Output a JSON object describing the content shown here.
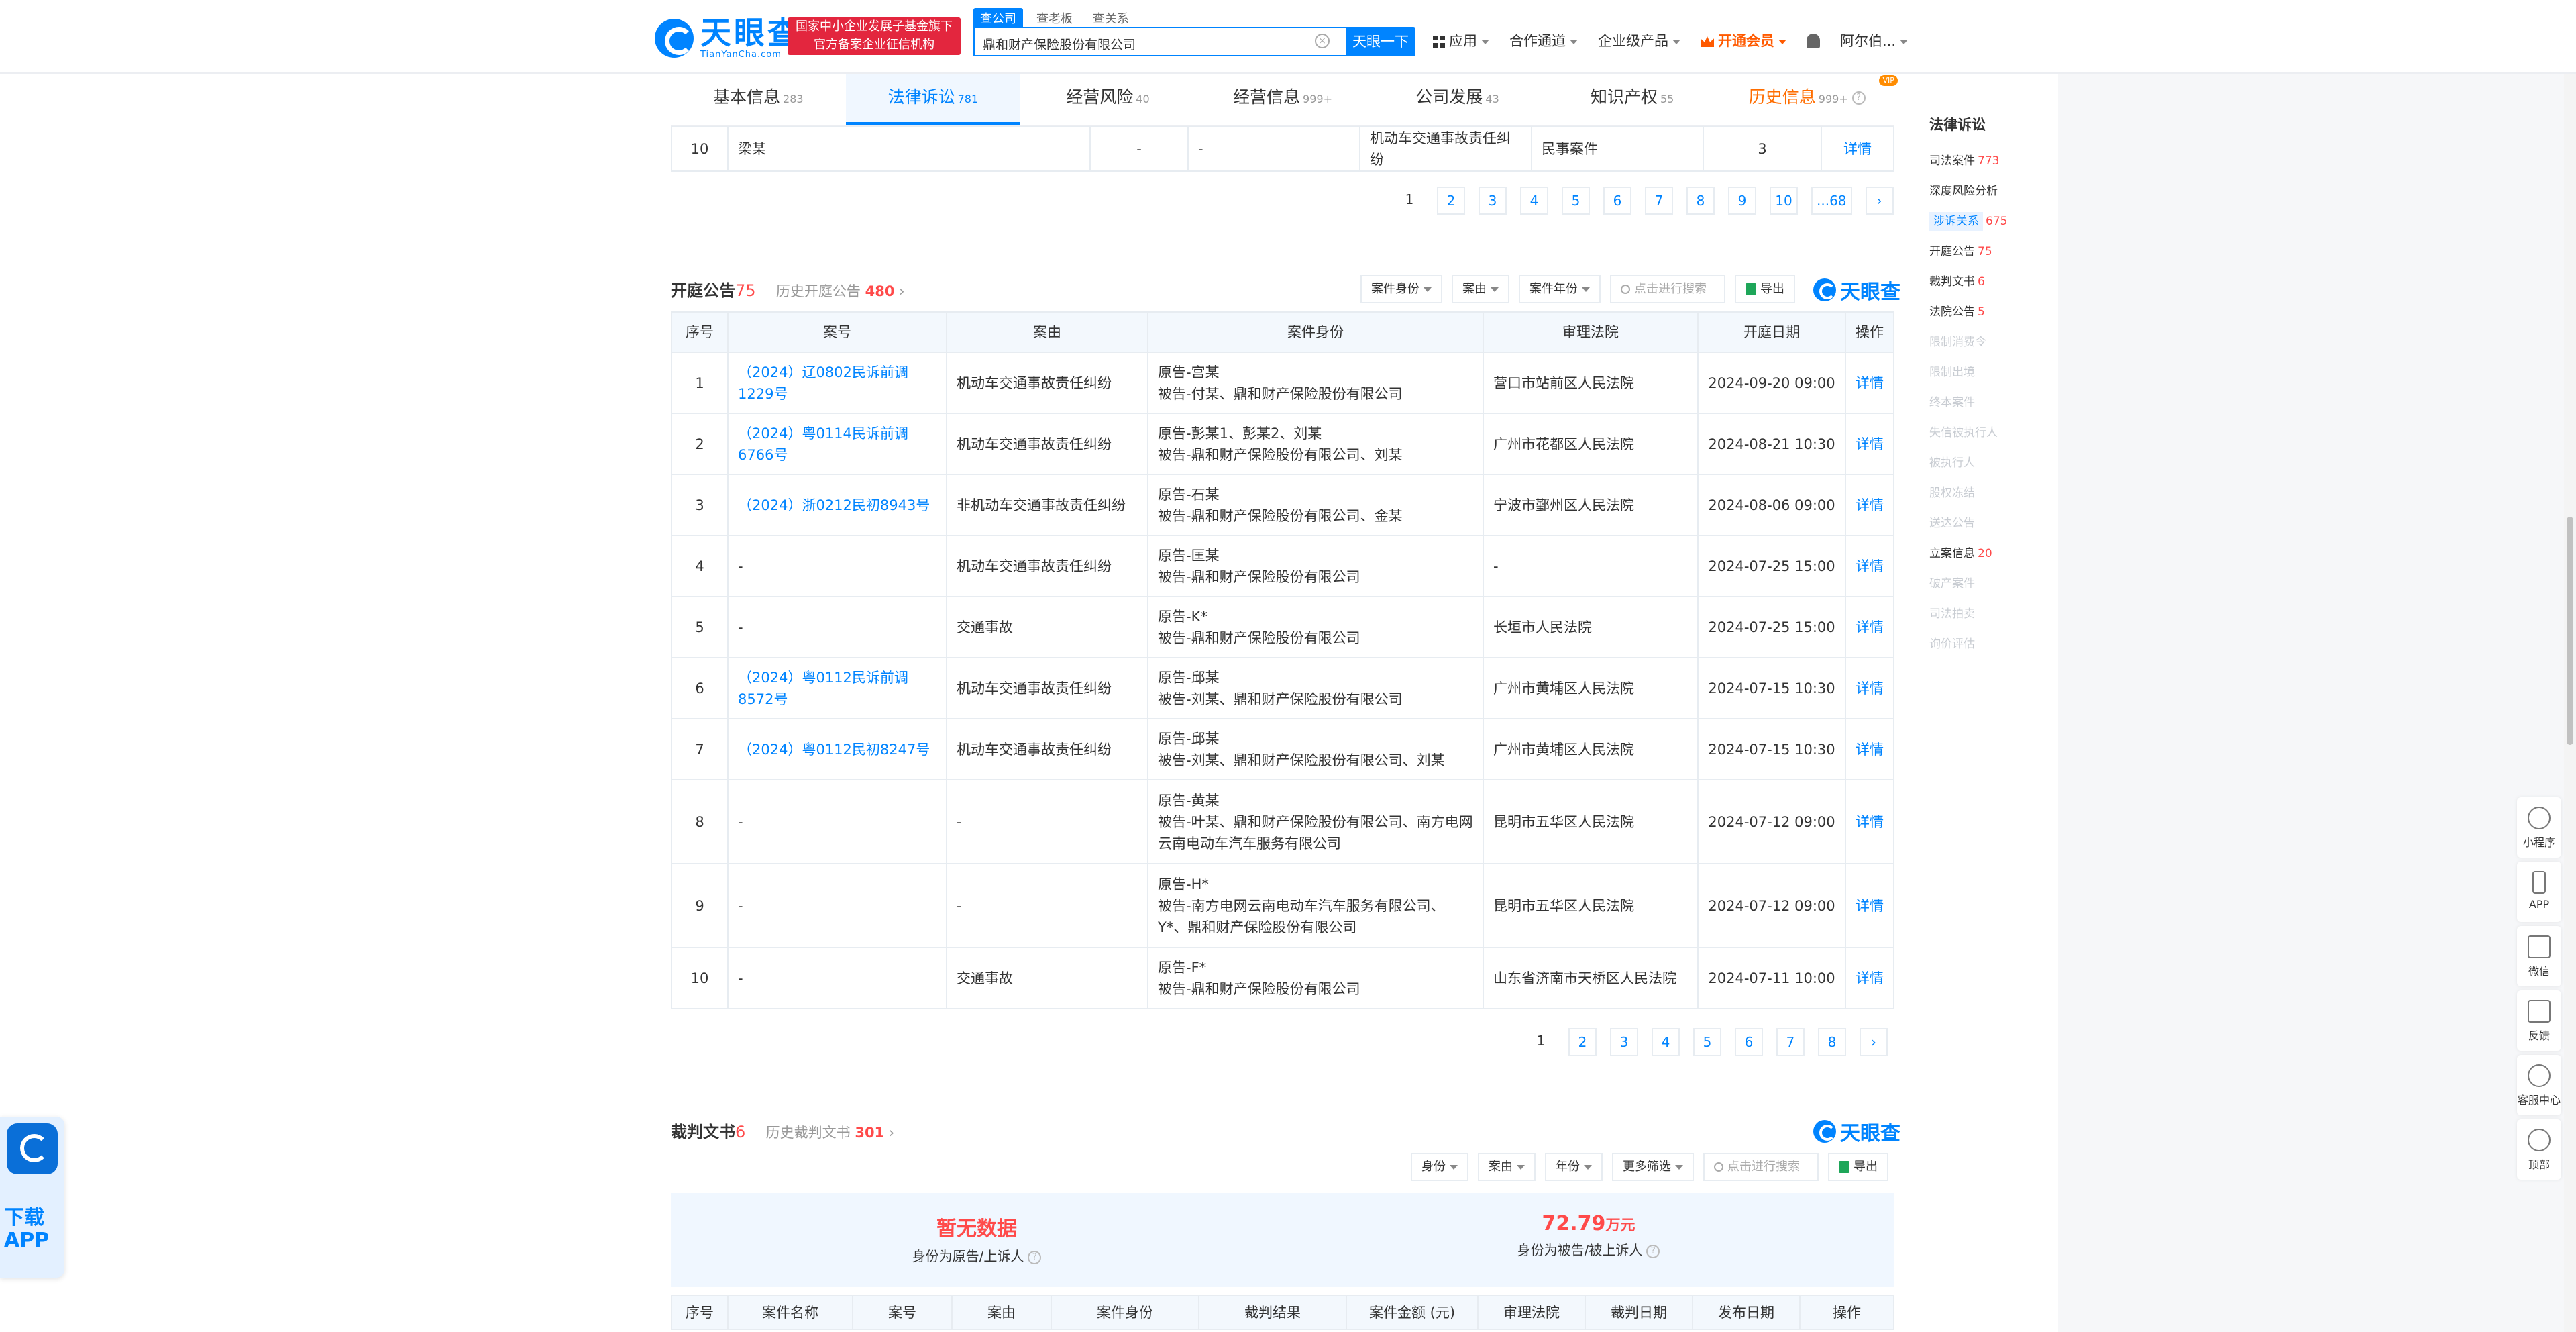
{
  "header": {
    "logo_cn": "天眼查",
    "logo_en": "TianYanCha.com",
    "badge_line1": "国家中小企业发展子基金旗下",
    "badge_line2": "官方备案企业征信机构",
    "search_tabs": [
      "查公司",
      "查老板",
      "查关系"
    ],
    "search_value": "鼎和财产保险股份有限公司",
    "search_button": "天眼一下",
    "nav": [
      "应用",
      "合作通道",
      "企业级产品",
      "开通会员",
      "阿尔伯..."
    ]
  },
  "tabs": [
    {
      "label": "基本信息",
      "count": "283"
    },
    {
      "label": "法律诉讼",
      "count": "781"
    },
    {
      "label": "经营风险",
      "count": "40"
    },
    {
      "label": "经营信息",
      "count": "999+"
    },
    {
      "label": "公司发展",
      "count": "43"
    },
    {
      "label": "知识产权",
      "count": "55"
    },
    {
      "label": "历史信息",
      "count": "999+"
    }
  ],
  "vip_tag": "VIP",
  "prev_table": {
    "row": {
      "no": "10",
      "party": "梁某",
      "c1": "-",
      "c2": "-",
      "reason": "机动车交通事故责任纠纷",
      "type": "民事案件",
      "count": "3",
      "action": "详情"
    }
  },
  "pager1": [
    "1",
    "2",
    "3",
    "4",
    "5",
    "6",
    "7",
    "8",
    "9",
    "10",
    "...68",
    "›"
  ],
  "court_notice": {
    "title": "开庭公告",
    "count": "75",
    "hist_label": "历史开庭公告",
    "hist_count": "480",
    "filters": [
      "案件身份",
      "案由",
      "案件年份"
    ],
    "search_placeholder": "点击进行搜索",
    "export": "导出",
    "brand": "天眼查",
    "headers": [
      "序号",
      "案号",
      "案由",
      "案件身份",
      "审理法院",
      "开庭日期",
      "操作"
    ],
    "rows": [
      {
        "no": "1",
        "case": "（2024）辽0802民诉前调1229号",
        "reason": "机动车交通事故责任纠纷",
        "plaintiff": "原告-宫某",
        "defendant": "被告-付某、鼎和财产保险股份有限公司",
        "court": "营口市站前区人民法院",
        "date": "2024-09-20 09:00",
        "action": "详情"
      },
      {
        "no": "2",
        "case": "（2024）粤0114民诉前调6766号",
        "reason": "机动车交通事故责任纠纷",
        "plaintiff": "原告-彭某1、彭某2、刘某",
        "defendant": "被告-鼎和财产保险股份有限公司、刘某",
        "court": "广州市花都区人民法院",
        "date": "2024-08-21 10:30",
        "action": "详情"
      },
      {
        "no": "3",
        "case": "（2024）浙0212民初8943号",
        "reason": "非机动车交通事故责任纠纷",
        "plaintiff": "原告-石某",
        "defendant": "被告-鼎和财产保险股份有限公司、金某",
        "court": "宁波市鄞州区人民法院",
        "date": "2024-08-06 09:00",
        "action": "详情"
      },
      {
        "no": "4",
        "case": "-",
        "reason": "机动车交通事故责任纠纷",
        "plaintiff": "原告-匡某",
        "defendant": "被告-鼎和财产保险股份有限公司",
        "court": "-",
        "date": "2024-07-25 15:00",
        "action": "详情"
      },
      {
        "no": "5",
        "case": "-",
        "reason": "交通事故",
        "plaintiff": "原告-K*",
        "defendant": "被告-鼎和财产保险股份有限公司",
        "court": "长垣市人民法院",
        "date": "2024-07-25 15:00",
        "action": "详情"
      },
      {
        "no": "6",
        "case": "（2024）粤0112民诉前调8572号",
        "reason": "机动车交通事故责任纠纷",
        "plaintiff": "原告-邱某",
        "defendant": "被告-刘某、鼎和财产保险股份有限公司",
        "court": "广州市黄埔区人民法院",
        "date": "2024-07-15 10:30",
        "action": "详情"
      },
      {
        "no": "7",
        "case": "（2024）粤0112民初8247号",
        "reason": "机动车交通事故责任纠纷",
        "plaintiff": "原告-邱某",
        "defendant": "被告-刘某、鼎和财产保险股份有限公司、刘某",
        "court": "广州市黄埔区人民法院",
        "date": "2024-07-15 10:30",
        "action": "详情"
      },
      {
        "no": "8",
        "case": "-",
        "reason": "-",
        "plaintiff": "原告-黄某",
        "defendant": "被告-叶某、鼎和财产保险股份有限公司、南方电网云南电动车汽车服务有限公司",
        "court": "昆明市五华区人民法院",
        "date": "2024-07-12 09:00",
        "action": "详情"
      },
      {
        "no": "9",
        "case": "-",
        "reason": "-",
        "plaintiff": "原告-H*",
        "defendant": "被告-南方电网云南电动车汽车服务有限公司、Y*、鼎和财产保险股份有限公司",
        "court": "昆明市五华区人民法院",
        "date": "2024-07-12 09:00",
        "action": "详情"
      },
      {
        "no": "10",
        "case": "-",
        "reason": "交通事故",
        "plaintiff": "原告-F*",
        "defendant": "被告-鼎和财产保险股份有限公司",
        "court": "山东省济南市天桥区人民法院",
        "date": "2024-07-11 10:00",
        "action": "详情"
      }
    ]
  },
  "pager2": [
    "1",
    "2",
    "3",
    "4",
    "5",
    "6",
    "7",
    "8",
    "›"
  ],
  "judgment": {
    "title": "裁判文书",
    "count": "6",
    "hist_label": "历史裁判文书",
    "hist_count": "301",
    "filters": [
      "身份",
      "案由",
      "年份",
      "更多筛选"
    ],
    "search_placeholder": "点击进行搜索",
    "export": "导出",
    "brand": "天眼查",
    "stat_left_value": "暂无数据",
    "stat_left_label": "身份为原告/上诉人",
    "stat_right_value": "72.79",
    "stat_right_unit": "万元",
    "stat_right_label": "身份为被告/被上诉人",
    "headers": [
      "序号",
      "案件名称",
      "案号",
      "案由",
      "案件身份",
      "裁判结果",
      "案件金额 (元)",
      "审理法院",
      "裁判日期",
      "发布日期",
      "操作"
    ]
  },
  "sidebar": {
    "title": "法律诉讼",
    "items": [
      {
        "label": "司法案件",
        "count": "773",
        "dim": false,
        "active": false
      },
      {
        "label": "深度风险分析",
        "count": "",
        "dim": false,
        "active": false
      },
      {
        "label": "涉诉关系",
        "count": "675",
        "dim": false,
        "active": true
      },
      {
        "label": "开庭公告",
        "count": "75",
        "dim": false,
        "active": false
      },
      {
        "label": "裁判文书",
        "count": "6",
        "dim": false,
        "active": false
      },
      {
        "label": "法院公告",
        "count": "5",
        "dim": false,
        "active": false
      },
      {
        "label": "限制消费令",
        "count": "",
        "dim": true,
        "active": false
      },
      {
        "label": "限制出境",
        "count": "",
        "dim": true,
        "active": false
      },
      {
        "label": "终本案件",
        "count": "",
        "dim": true,
        "active": false
      },
      {
        "label": "失信被执行人",
        "count": "",
        "dim": true,
        "active": false
      },
      {
        "label": "被执行人",
        "count": "",
        "dim": true,
        "active": false
      },
      {
        "label": "股权冻结",
        "count": "",
        "dim": true,
        "active": false
      },
      {
        "label": "送达公告",
        "count": "",
        "dim": true,
        "active": false
      },
      {
        "label": "立案信息",
        "count": "20",
        "dim": false,
        "active": false
      },
      {
        "label": "破产案件",
        "count": "",
        "dim": true,
        "active": false
      },
      {
        "label": "司法拍卖",
        "count": "",
        "dim": true,
        "active": false
      },
      {
        "label": "询价评估",
        "count": "",
        "dim": true,
        "active": false
      }
    ]
  },
  "float_tools": [
    "小程序",
    "APP",
    "微信",
    "反馈",
    "客服中心",
    "顶部"
  ],
  "app_download": {
    "line1": "下载",
    "line2": "APP"
  }
}
